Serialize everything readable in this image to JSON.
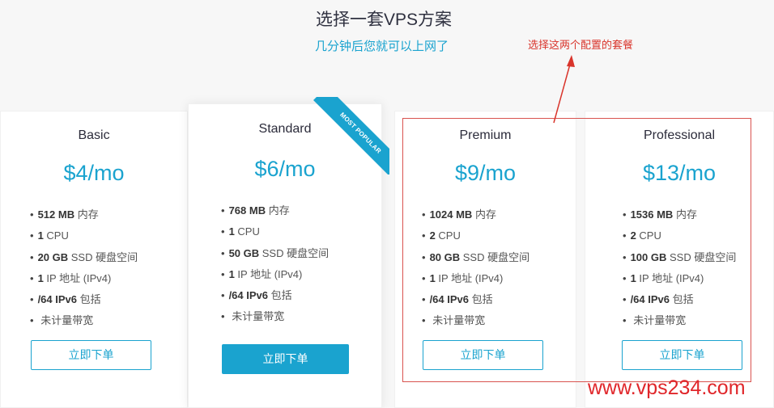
{
  "header": {
    "title": "选择一套VPS方案",
    "subtitle": "几分钟后您就可以上网了"
  },
  "annotation": {
    "note": "选择这两个配置的套餐",
    "watermark": "www.vps234.com"
  },
  "ribbon": "MOST POPULAR",
  "plans": [
    {
      "name": "Basic",
      "price": "$4/mo",
      "features": [
        [
          "512 MB",
          "内存"
        ],
        [
          "1",
          "CPU"
        ],
        [
          "20 GB",
          "SSD 硬盘空间"
        ],
        [
          "1",
          "IP 地址 (IPv4)"
        ],
        [
          "/64 IPv6",
          "包括"
        ],
        [
          "",
          "未计量带宽"
        ]
      ],
      "button": "立即下单"
    },
    {
      "name": "Standard",
      "price": "$6/mo",
      "features": [
        [
          "768 MB",
          "内存"
        ],
        [
          "1",
          "CPU"
        ],
        [
          "50 GB",
          "SSD 硬盘空间"
        ],
        [
          "1",
          "IP 地址 (IPv4)"
        ],
        [
          "/64 IPv6",
          "包括"
        ],
        [
          "",
          "未计量带宽"
        ]
      ],
      "button": "立即下单"
    },
    {
      "name": "Premium",
      "price": "$9/mo",
      "features": [
        [
          "1024 MB",
          "内存"
        ],
        [
          "2",
          "CPU"
        ],
        [
          "80 GB",
          "SSD 硬盘空间"
        ],
        [
          "1",
          "IP 地址 (IPv4)"
        ],
        [
          "/64 IPv6",
          "包括"
        ],
        [
          "",
          "未计量带宽"
        ]
      ],
      "button": "立即下单"
    },
    {
      "name": "Professional",
      "price": "$13/mo",
      "features": [
        [
          "1536 MB",
          "内存"
        ],
        [
          "2",
          "CPU"
        ],
        [
          "100 GB",
          "SSD 硬盘空间"
        ],
        [
          "1",
          "IP 地址 (IPv4)"
        ],
        [
          "/64 IPv6",
          "包括"
        ],
        [
          "",
          "未计量带宽"
        ]
      ],
      "button": "立即下单"
    }
  ],
  "colors": {
    "accent": "#1aa3cf",
    "annotation": "#d9342b"
  }
}
